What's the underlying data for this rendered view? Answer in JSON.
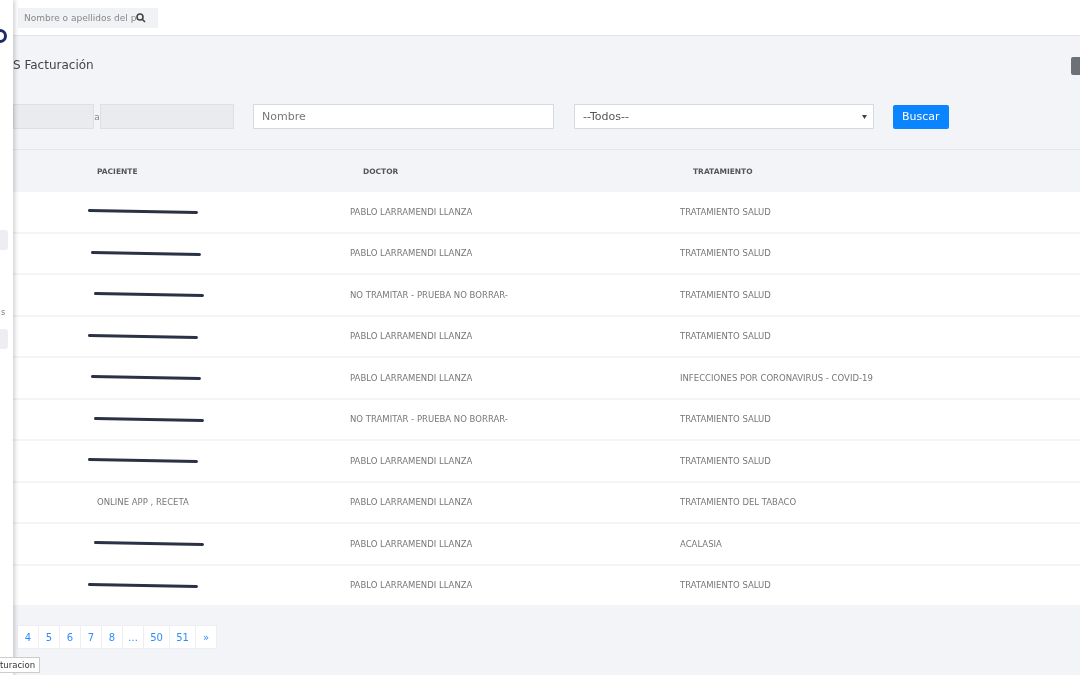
{
  "sidebar": {
    "label_fragment": "s"
  },
  "search": {
    "placeholder": "Nombre o apellidos del p"
  },
  "page": {
    "title": "S Facturación"
  },
  "filters": {
    "date_separator": "a",
    "name_placeholder": "Nombre",
    "select_value": "--Todos--",
    "button": "Buscar"
  },
  "table": {
    "columns": [
      "PACIENTE",
      "DOCTOR",
      "TRATAMIENTO"
    ],
    "rows": [
      {
        "redacted": true,
        "doctor": "PABLO LARRAMENDI LLANZA",
        "tratamiento": "TRATAMIENTO SALUD"
      },
      {
        "redacted": true,
        "doctor": "PABLO LARRAMENDI LLANZA",
        "tratamiento": "TRATAMIENTO SALUD"
      },
      {
        "redacted": true,
        "doctor": "NO TRAMITAR - PRUEBA NO BORRAR-",
        "tratamiento": "TRATAMIENTO SALUD"
      },
      {
        "redacted": true,
        "doctor": "PABLO LARRAMENDI LLANZA",
        "tratamiento": "TRATAMIENTO SALUD"
      },
      {
        "redacted": true,
        "doctor": "PABLO LARRAMENDI LLANZA",
        "tratamiento": "INFECCIONES POR CORONAVIRUS - COVID-19"
      },
      {
        "redacted": true,
        "doctor": "NO TRAMITAR - PRUEBA NO BORRAR-",
        "tratamiento": "TRATAMIENTO SALUD"
      },
      {
        "redacted": true,
        "doctor": "PABLO LARRAMENDI LLANZA",
        "tratamiento": "TRATAMIENTO SALUD"
      },
      {
        "paciente": "ONLINE APP , RECETA",
        "redacted": false,
        "doctor": "PABLO LARRAMENDI LLANZA",
        "tratamiento": "TRATAMIENTO DEL TABACO"
      },
      {
        "redacted": true,
        "doctor": "PABLO LARRAMENDI LLANZA",
        "tratamiento": "ACALASIA"
      },
      {
        "redacted": true,
        "doctor": "PABLO LARRAMENDI LLANZA",
        "tratamiento": "TRATAMIENTO SALUD"
      }
    ]
  },
  "pagination": [
    "4",
    "5",
    "6",
    "7",
    "8",
    "…",
    "50",
    "51",
    "»"
  ],
  "tooltip": "turacion"
}
